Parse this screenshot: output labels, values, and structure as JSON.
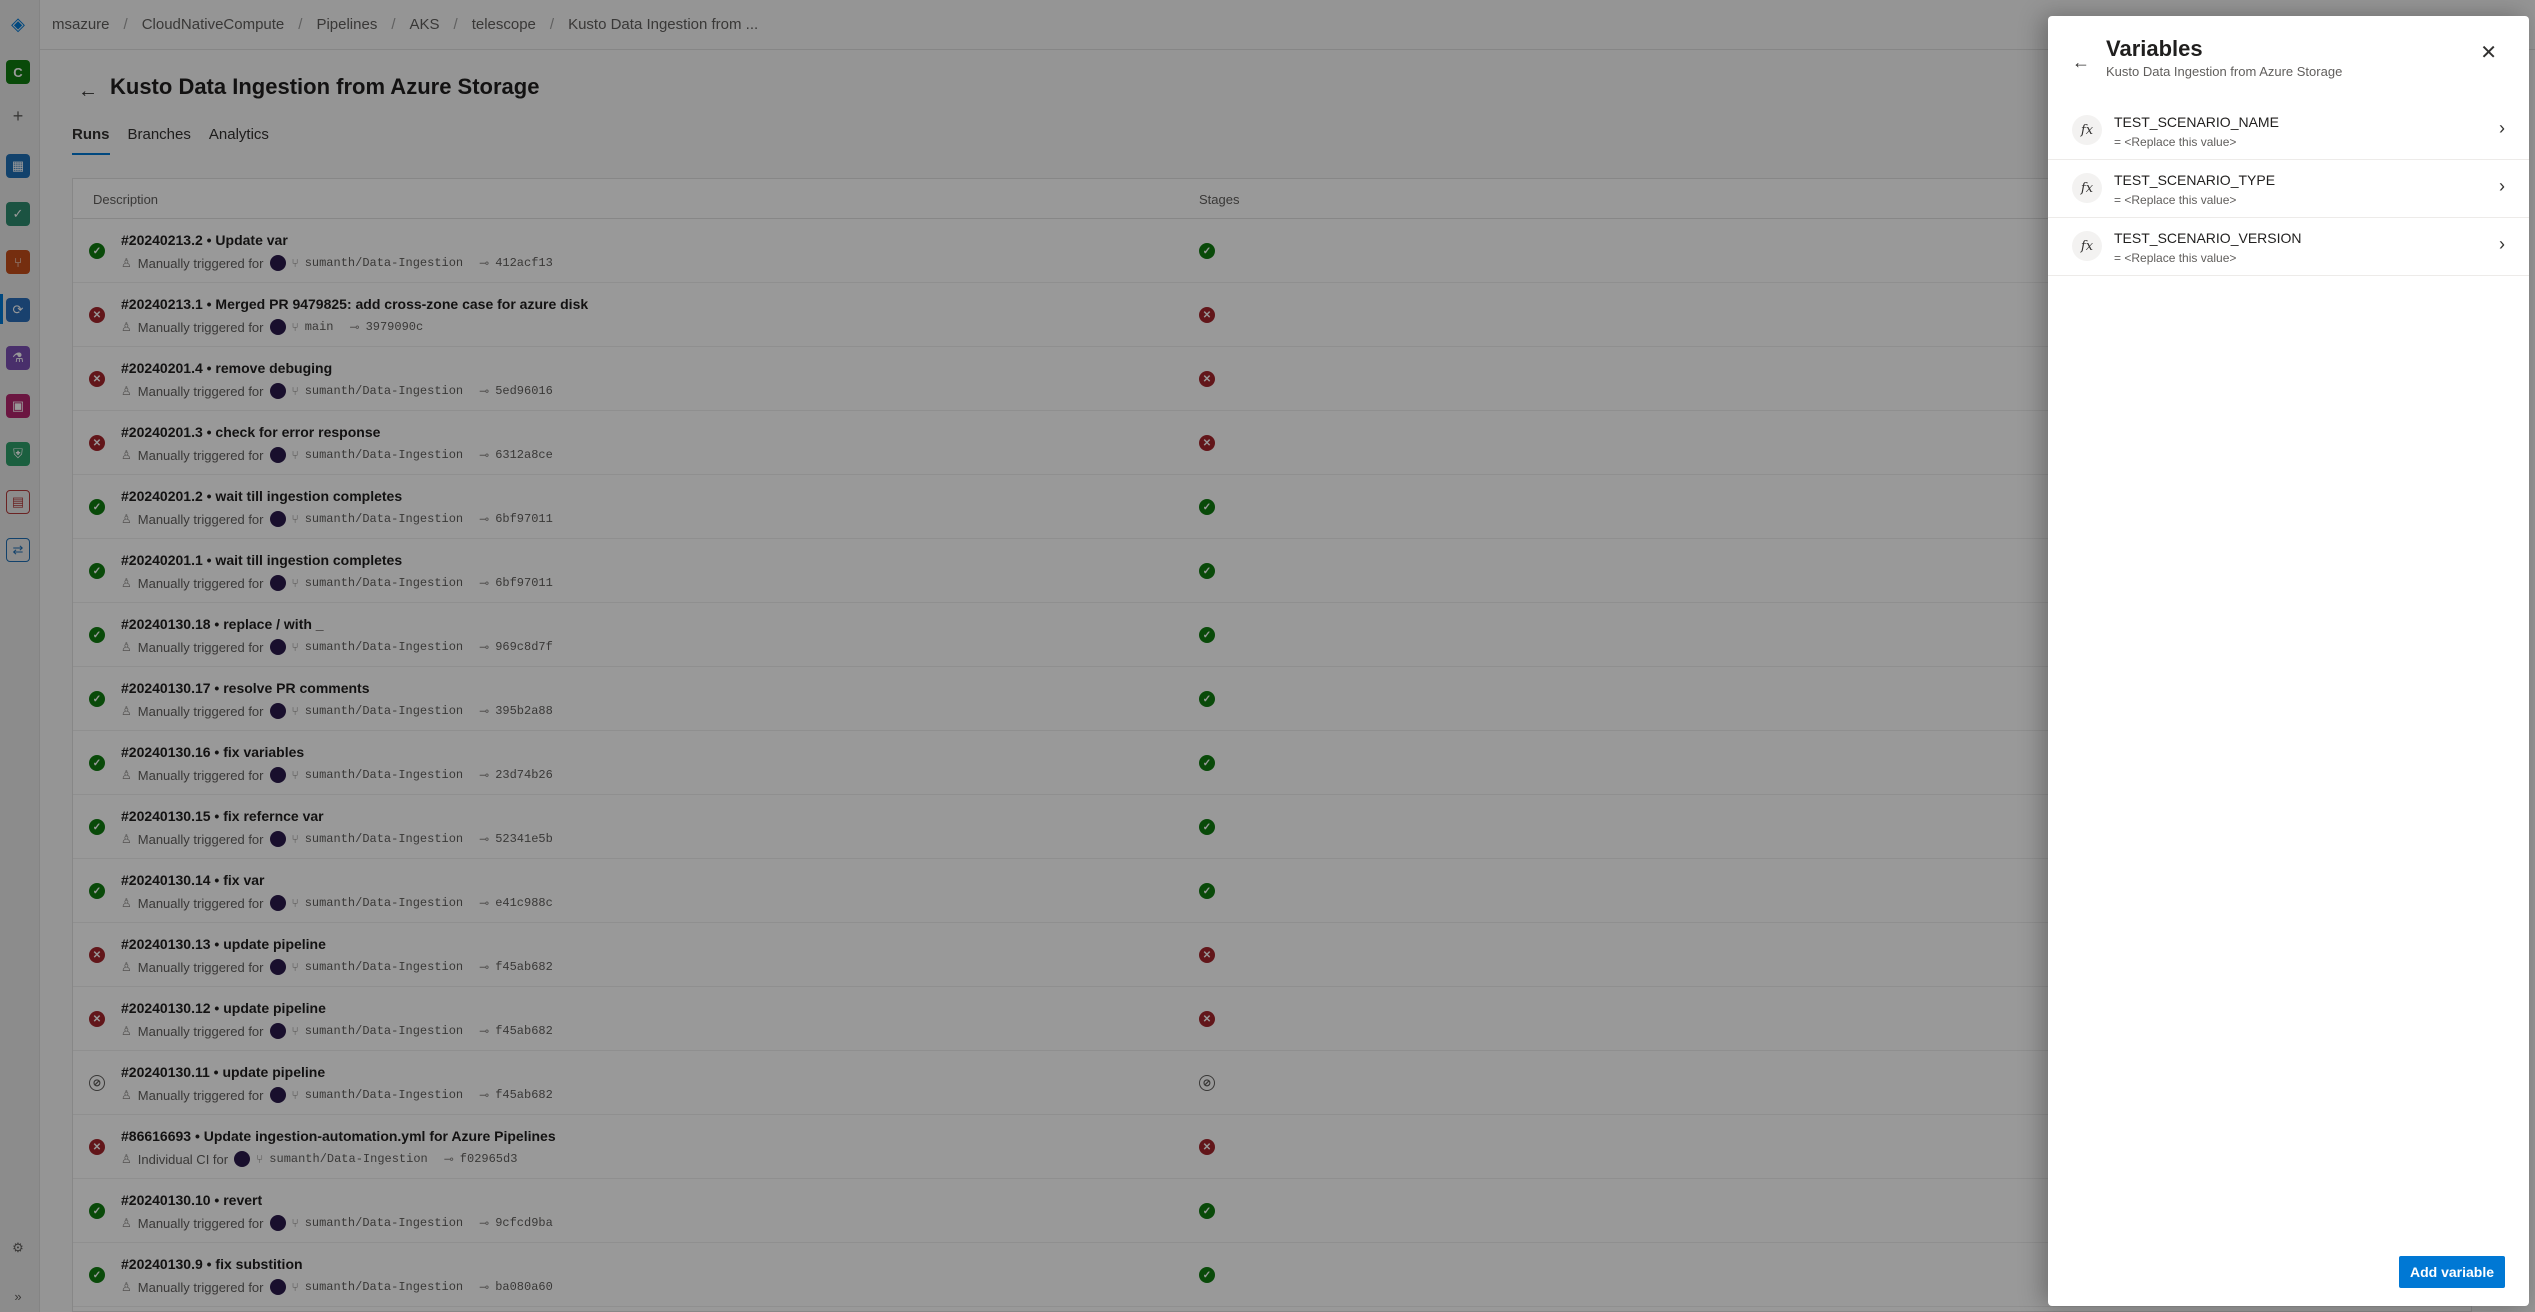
{
  "breadcrumb": [
    "msazure",
    "CloudNativeCompute",
    "Pipelines",
    "AKS",
    "telescope",
    "Kusto Data Ingestion from ..."
  ],
  "page": {
    "title": "Kusto Data Ingestion from Azure Storage",
    "tabs": [
      {
        "label": "Runs",
        "active": true
      },
      {
        "label": "Branches",
        "active": false
      },
      {
        "label": "Analytics",
        "active": false
      }
    ]
  },
  "table": {
    "headers": {
      "description": "Description",
      "stages": "Stages"
    },
    "rows": [
      {
        "title": "#20240213.2 • Update var",
        "status": "ok",
        "trigger": "Manually triggered for",
        "branch": "sumanth/Data-Ingestion",
        "commit": "412acf13"
      },
      {
        "title": "#20240213.1 • Merged PR 9479825: add cross-zone case for azure disk",
        "status": "fail",
        "trigger": "Manually triggered for",
        "branch": "main",
        "commit": "3979090c"
      },
      {
        "title": "#20240201.4 • remove debuging",
        "status": "fail",
        "trigger": "Manually triggered for",
        "branch": "sumanth/Data-Ingestion",
        "commit": "5ed96016"
      },
      {
        "title": "#20240201.3 • check for error response",
        "status": "fail",
        "trigger": "Manually triggered for",
        "branch": "sumanth/Data-Ingestion",
        "commit": "6312a8ce"
      },
      {
        "title": "#20240201.2 • wait till ingestion completes",
        "status": "ok",
        "trigger": "Manually triggered for",
        "branch": "sumanth/Data-Ingestion",
        "commit": "6bf97011"
      },
      {
        "title": "#20240201.1 • wait till ingestion completes",
        "status": "ok",
        "trigger": "Manually triggered for",
        "branch": "sumanth/Data-Ingestion",
        "commit": "6bf97011"
      },
      {
        "title": "#20240130.18 • replace / with _",
        "status": "ok",
        "trigger": "Manually triggered for",
        "branch": "sumanth/Data-Ingestion",
        "commit": "969c8d7f"
      },
      {
        "title": "#20240130.17 • resolve PR comments",
        "status": "ok",
        "trigger": "Manually triggered for",
        "branch": "sumanth/Data-Ingestion",
        "commit": "395b2a88"
      },
      {
        "title": "#20240130.16 • fix variables",
        "status": "ok",
        "trigger": "Manually triggered for",
        "branch": "sumanth/Data-Ingestion",
        "commit": "23d74b26"
      },
      {
        "title": "#20240130.15 • fix refernce var",
        "status": "ok",
        "trigger": "Manually triggered for",
        "branch": "sumanth/Data-Ingestion",
        "commit": "52341e5b"
      },
      {
        "title": "#20240130.14 • fix var",
        "status": "ok",
        "trigger": "Manually triggered for",
        "branch": "sumanth/Data-Ingestion",
        "commit": "e41c988c"
      },
      {
        "title": "#20240130.13 • update pipeline",
        "status": "fail",
        "trigger": "Manually triggered for",
        "branch": "sumanth/Data-Ingestion",
        "commit": "f45ab682"
      },
      {
        "title": "#20240130.12 • update pipeline",
        "status": "fail",
        "trigger": "Manually triggered for",
        "branch": "sumanth/Data-Ingestion",
        "commit": "f45ab682"
      },
      {
        "title": "#20240130.11 • update pipeline",
        "status": "skip",
        "trigger": "Manually triggered for",
        "branch": "sumanth/Data-Ingestion",
        "commit": "f45ab682"
      },
      {
        "title": "#86616693 • Update ingestion-automation.yml for Azure Pipelines",
        "status": "fail",
        "trigger": "Individual CI for",
        "branch": "sumanth/Data-Ingestion",
        "commit": "f02965d3"
      },
      {
        "title": "#20240130.10 • revert",
        "status": "ok",
        "trigger": "Manually triggered for",
        "branch": "sumanth/Data-Ingestion",
        "commit": "9cfcd9ba"
      },
      {
        "title": "#20240130.9 • fix substition",
        "status": "ok",
        "trigger": "Manually triggered for",
        "branch": "sumanth/Data-Ingestion",
        "commit": "ba080a60"
      }
    ]
  },
  "panel": {
    "title": "Variables",
    "subtitle": "Kusto Data Ingestion from Azure Storage",
    "fx_symbol": "fx",
    "variables": [
      {
        "name": "TEST_SCENARIO_NAME",
        "value": "= <Replace this value>"
      },
      {
        "name": "TEST_SCENARIO_TYPE",
        "value": "= <Replace this value>"
      },
      {
        "name": "TEST_SCENARIO_VERSION",
        "value": "= <Replace this value>"
      }
    ],
    "add_button": "Add variable"
  },
  "org_initial": "C",
  "colors": {
    "accent": "#0078d4",
    "success": "#107c10",
    "failure": "#a4262c"
  }
}
